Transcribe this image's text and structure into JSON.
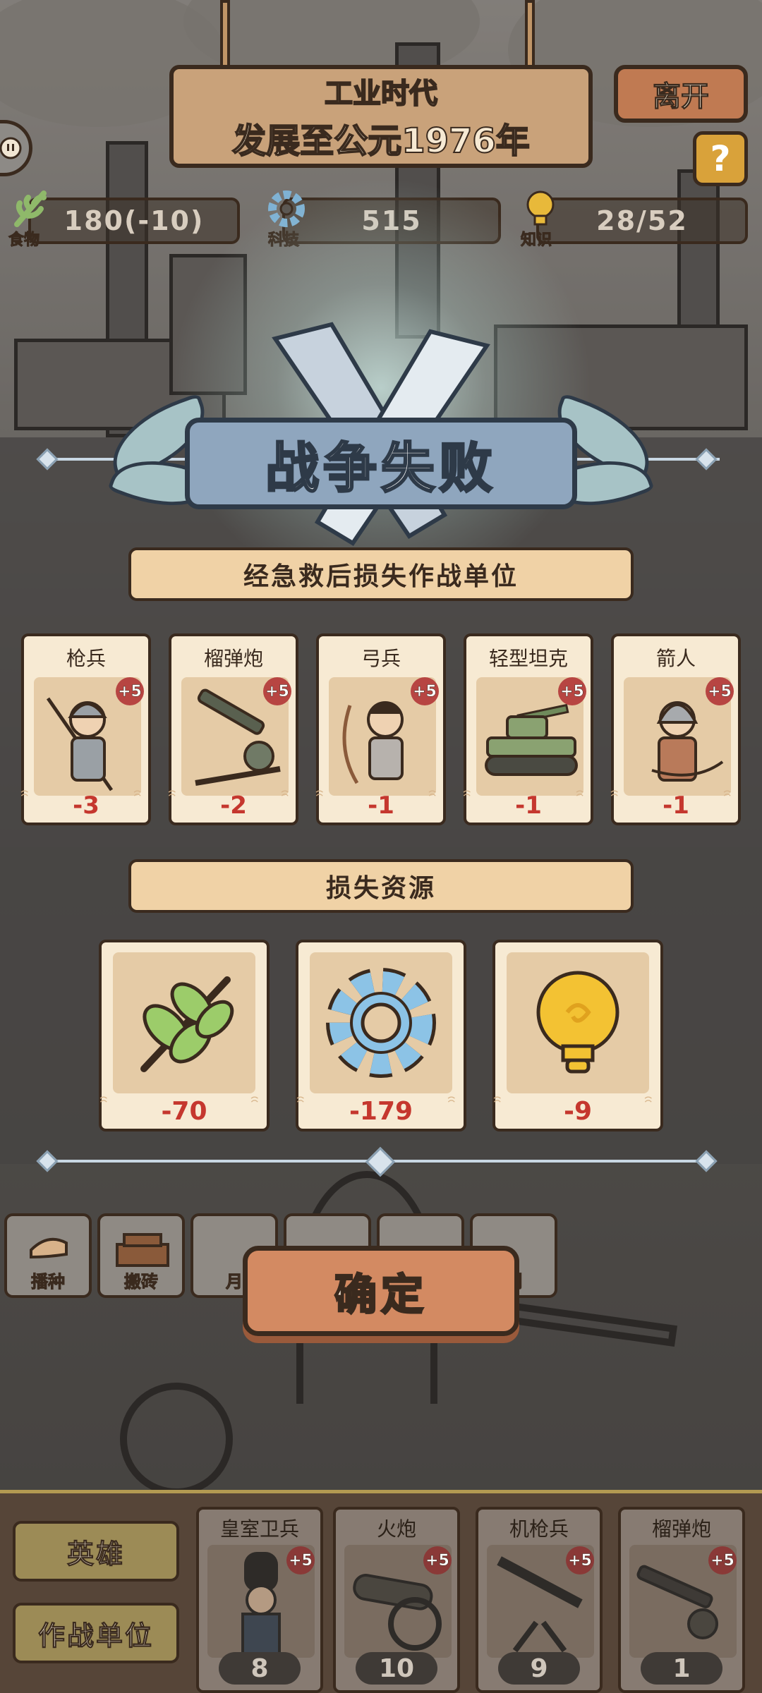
{
  "header": {
    "era_name": "工业时代",
    "era_progress": "发展至公元1976年",
    "leave_label": "离开",
    "help_label": "?"
  },
  "resources": {
    "food": {
      "label": "食物",
      "value": "180(-10)"
    },
    "tech": {
      "label": "科技",
      "value": "515"
    },
    "knowledge": {
      "label": "知识",
      "value": "28/52"
    }
  },
  "dialog": {
    "title": "战争失败",
    "units_section": "经急救后损失作战单位",
    "units": [
      {
        "name": "枪兵",
        "badge": "+5",
        "loss": "-3"
      },
      {
        "name": "榴弹炮",
        "badge": "+5",
        "loss": "-2"
      },
      {
        "name": "弓兵",
        "badge": "+5",
        "loss": "-1"
      },
      {
        "name": "轻型坦克",
        "badge": "+5",
        "loss": "-1"
      },
      {
        "name": "箭人",
        "badge": "+5",
        "loss": "-1"
      }
    ],
    "resources_section": "损失资源",
    "resource_losses": [
      {
        "icon": "leaf-icon",
        "loss": "-70"
      },
      {
        "icon": "gear-icon",
        "loss": "-179"
      },
      {
        "icon": "lightbulb-icon",
        "loss": "-9"
      }
    ],
    "confirm_label": "确定"
  },
  "actions": [
    {
      "label": "播种"
    },
    {
      "label": "搬砖"
    },
    {
      "label": "月"
    },
    {
      "label": ""
    },
    {
      "label": ""
    },
    {
      "label": "制"
    }
  ],
  "bottom": {
    "heroes_label": "英雄",
    "units_label": "作战单位",
    "cards": [
      {
        "name": "皇室卫兵",
        "badge": "+5",
        "count": "8"
      },
      {
        "name": "火炮",
        "badge": "+5",
        "count": "10"
      },
      {
        "name": "机枪兵",
        "badge": "+5",
        "count": "9"
      },
      {
        "name": "榴弹炮",
        "badge": "+5",
        "count": "1"
      }
    ]
  },
  "colors": {
    "loss_red": "#c5372e",
    "banner_blue": "#8fa6be",
    "confirm_orange": "#d38a62",
    "card_cream": "#f7ead3"
  }
}
